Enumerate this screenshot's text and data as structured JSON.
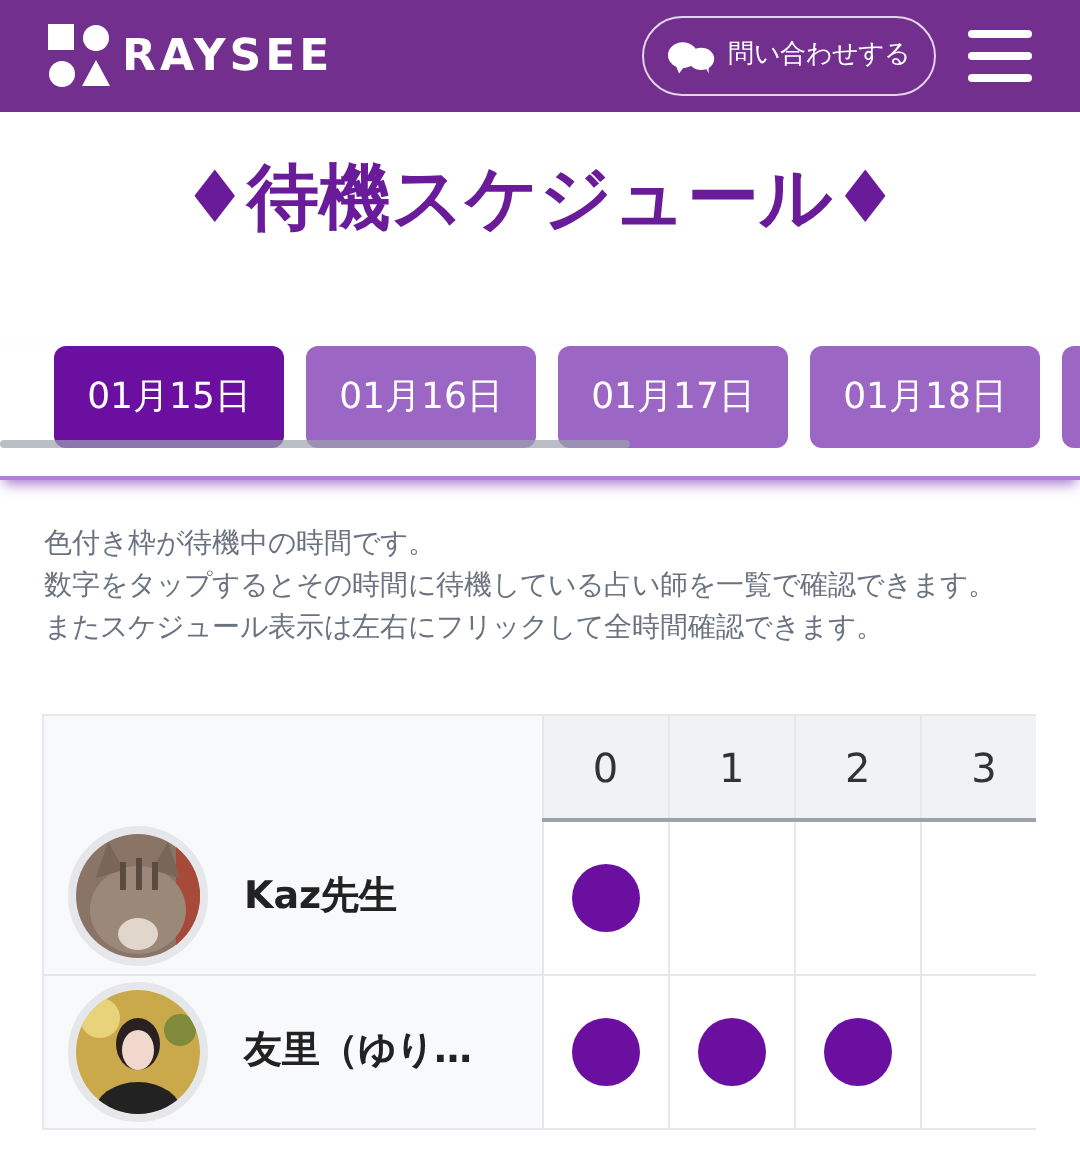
{
  "header": {
    "logo": "RAYSEE",
    "contact_button": "問い合わせする"
  },
  "title": "♦待機スケジュール♦",
  "tabs": [
    {
      "label": "01月15日",
      "selected": true
    },
    {
      "label": "01月16日",
      "selected": false
    },
    {
      "label": "01月17日",
      "selected": false
    },
    {
      "label": "01月18日",
      "selected": false
    }
  ],
  "notes": [
    "色付き枠が待機中の時間です。",
    "数字をタップするとその時間に待機している占い師を一覧で確認できます。",
    "またスケジュール表示は左右にフリックして全時間確認できます。"
  ],
  "schedule": {
    "hours": [
      "0",
      "1",
      "2",
      "3"
    ],
    "rows": [
      {
        "name": "Kaz先生",
        "slots": [
          {
            "on": true
          },
          {
            "on": false
          },
          {
            "on": false
          },
          {
            "on": false
          }
        ]
      },
      {
        "name": "友里（ゆり…",
        "slots": [
          {
            "on": true
          },
          {
            "on": true
          },
          {
            "on": true
          },
          {
            "on": false
          }
        ]
      }
    ]
  }
}
